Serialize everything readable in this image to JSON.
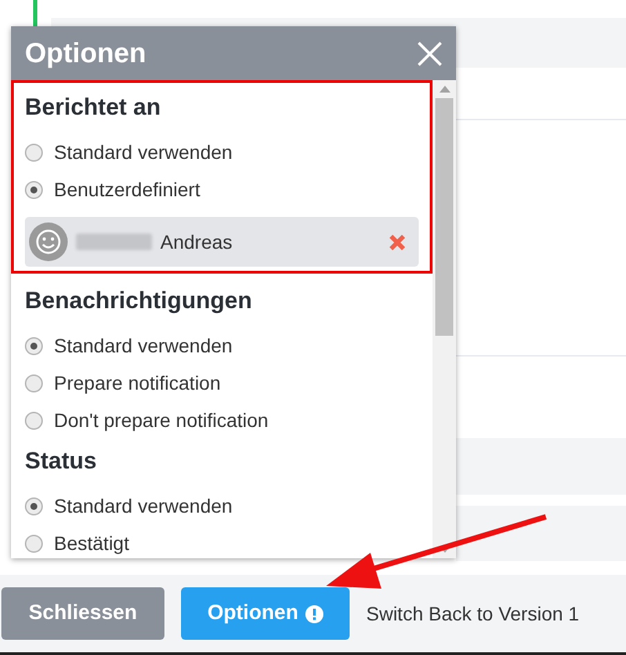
{
  "dialog": {
    "title": "Optionen",
    "sections": [
      {
        "title": "Berichtet an",
        "highlighted": true,
        "options": [
          {
            "label": "Standard verwenden",
            "selected": false
          },
          {
            "label": "Benutzerdefiniert",
            "selected": true
          }
        ],
        "assignee": {
          "name": "Andreas"
        }
      },
      {
        "title": "Benachrichtigungen",
        "highlighted": false,
        "options": [
          {
            "label": "Standard verwenden",
            "selected": true
          },
          {
            "label": "Prepare notification",
            "selected": false
          },
          {
            "label": "Don't prepare notification",
            "selected": false
          }
        ]
      },
      {
        "title": "Status",
        "highlighted": false,
        "options": [
          {
            "label": "Standard verwenden",
            "selected": true
          },
          {
            "label": "Bestätigt",
            "selected": false
          }
        ]
      }
    ]
  },
  "footer": {
    "close_button": "Schliessen",
    "options_button": "Optionen",
    "switch_link": "Switch Back to Version 1"
  }
}
